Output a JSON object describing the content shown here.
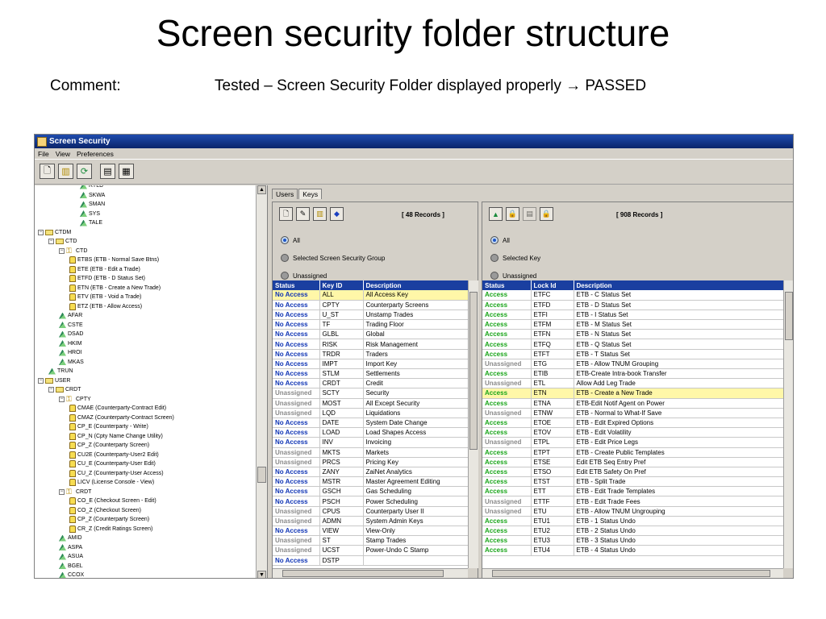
{
  "slide": {
    "title": "Screen security folder structure",
    "comment_label": "Comment:",
    "comment_text": "Tested – Screen Security Folder displayed properly → PASSED"
  },
  "window": {
    "title": "Screen Security"
  },
  "menu": [
    "File",
    "View",
    "Preferences"
  ],
  "toolbar_icons": [
    "new-document-icon",
    "trash-icon",
    "refresh-icon",
    "document-icon",
    "grid-icon"
  ],
  "tree": [
    {
      "label": "RTLD",
      "level": 4,
      "type": "group"
    },
    {
      "label": "SKWA",
      "level": 4,
      "type": "group"
    },
    {
      "label": "SMAN",
      "level": 4,
      "type": "group"
    },
    {
      "label": "SYS",
      "level": 4,
      "type": "group"
    },
    {
      "label": "TALE",
      "level": 4,
      "type": "group"
    },
    {
      "label": "CTDM",
      "level": 0,
      "type": "folder"
    },
    {
      "label": "CTD",
      "level": 1,
      "type": "folder"
    },
    {
      "label": "CTD",
      "level": 2,
      "type": "key"
    },
    {
      "label": "ETBS (ETB - Normal Save Btns)",
      "level": 3,
      "type": "lock"
    },
    {
      "label": "ETE  (ETB - Edit a Trade)",
      "level": 3,
      "type": "lock"
    },
    {
      "label": "ETFD (ETB - D Status Set)",
      "level": 3,
      "type": "lock"
    },
    {
      "label": "ETN  (ETB - Create a New Trade)",
      "level": 3,
      "type": "lock"
    },
    {
      "label": "ETV  (ETB - Void a Trade)",
      "level": 3,
      "type": "lock"
    },
    {
      "label": "ETZ  (ETB - Allow Access)",
      "level": 3,
      "type": "lock"
    },
    {
      "label": "AFAR",
      "level": 2,
      "type": "group"
    },
    {
      "label": "CSTE",
      "level": 2,
      "type": "group"
    },
    {
      "label": "DSAD",
      "level": 2,
      "type": "group"
    },
    {
      "label": "HKIM",
      "level": 2,
      "type": "group"
    },
    {
      "label": "HROI",
      "level": 2,
      "type": "group"
    },
    {
      "label": "MKAS",
      "level": 2,
      "type": "group"
    },
    {
      "label": "TRUN",
      "level": 1,
      "type": "group"
    },
    {
      "label": "USER",
      "level": 0,
      "type": "folder"
    },
    {
      "label": "CRDT",
      "level": 1,
      "type": "folder"
    },
    {
      "label": "CPTY",
      "level": 2,
      "type": "key"
    },
    {
      "label": "CMAE (Counterparty-Contract Edit)",
      "level": 3,
      "type": "lock"
    },
    {
      "label": "CMAZ (Counterparty-Contract Screen)",
      "level": 3,
      "type": "lock"
    },
    {
      "label": "CP_E (Counterparty - Write)",
      "level": 3,
      "type": "lock"
    },
    {
      "label": "CP_N (Cpty Name Change Utility)",
      "level": 3,
      "type": "lock"
    },
    {
      "label": "CP_Z (Counterparty Screen)",
      "level": 3,
      "type": "lock"
    },
    {
      "label": "CU2E (Counterparty-User2 Edit)",
      "level": 3,
      "type": "lock"
    },
    {
      "label": "CU_E (Counterparty-User Edit)",
      "level": 3,
      "type": "lock"
    },
    {
      "label": "CU_Z (Counterparty-User Access)",
      "level": 3,
      "type": "lock"
    },
    {
      "label": "LICV (License Console - View)",
      "level": 3,
      "type": "lock"
    },
    {
      "label": "CRDT",
      "level": 2,
      "type": "key"
    },
    {
      "label": "CO_E (Checkout Screen - Edit)",
      "level": 3,
      "type": "lock"
    },
    {
      "label": "CO_Z (Checkout Screen)",
      "level": 3,
      "type": "lock"
    },
    {
      "label": "CP_Z (Counterparty Screen)",
      "level": 3,
      "type": "lock"
    },
    {
      "label": "CR_Z (Credit Ratings Screen)",
      "level": 3,
      "type": "lock"
    },
    {
      "label": "AMID",
      "level": 2,
      "type": "group"
    },
    {
      "label": "ASPA",
      "level": 2,
      "type": "group"
    },
    {
      "label": "ASUA",
      "level": 2,
      "type": "group"
    },
    {
      "label": "BGEL",
      "level": 2,
      "type": "group"
    },
    {
      "label": "CCOX",
      "level": 2,
      "type": "group"
    }
  ],
  "tabs": [
    "Users",
    "Keys"
  ],
  "left_panel": {
    "record_count": "[ 48 Records ]",
    "radios": [
      "All",
      "Selected Screen Security Group",
      "Unassigned"
    ],
    "columns": [
      "Status",
      "Key ID",
      "Description"
    ],
    "rows": [
      [
        "No Access",
        "ALL",
        "All Access Key"
      ],
      [
        "No Access",
        "CPTY",
        "Counterparty Screens"
      ],
      [
        "No Access",
        "U_ST",
        "Unstamp Trades"
      ],
      [
        "No Access",
        "TF",
        "Trading Floor"
      ],
      [
        "No Access",
        "GLBL",
        "Global"
      ],
      [
        "No Access",
        "RISK",
        "Risk Management"
      ],
      [
        "No Access",
        "TRDR",
        "Traders"
      ],
      [
        "No Access",
        "IMPT",
        "Import Key"
      ],
      [
        "No Access",
        "STLM",
        "Settlements"
      ],
      [
        "No Access",
        "CRDT",
        "Credit"
      ],
      [
        "Unassigned",
        "SCTY",
        "Security"
      ],
      [
        "Unassigned",
        "MOST",
        "All Except Security"
      ],
      [
        "Unassigned",
        "LQD",
        "Liquidations"
      ],
      [
        "No Access",
        "DATE",
        "System Date Change"
      ],
      [
        "No Access",
        "LOAD",
        "Load Shapes Access"
      ],
      [
        "No Access",
        "INV",
        "Invoicing"
      ],
      [
        "Unassigned",
        "MKTS",
        "Markets"
      ],
      [
        "Unassigned",
        "PRCS",
        "Pricing Key"
      ],
      [
        "No Access",
        "ZANY",
        "ZaiNet Analytics"
      ],
      [
        "No Access",
        "MSTR",
        "Master Agreement Editing"
      ],
      [
        "No Access",
        "GSCH",
        "Gas Scheduling"
      ],
      [
        "No Access",
        "PSCH",
        "Power Scheduling"
      ],
      [
        "Unassigned",
        "CPUS",
        "Counterparty User II"
      ],
      [
        "Unassigned",
        "ADMN",
        "System Admin Keys"
      ],
      [
        "No Access",
        "VIEW",
        "View-Only"
      ],
      [
        "Unassigned",
        "ST",
        "Stamp Trades"
      ],
      [
        "Unassigned",
        "UCST",
        "Power-Undo C Stamp"
      ],
      [
        "No Access",
        "DSTP",
        ""
      ]
    ],
    "selected_row": 0
  },
  "right_panel": {
    "record_count": "[ 908 Records ]",
    "radios": [
      "All",
      "Selected Key",
      "Unassigned"
    ],
    "columns": [
      "Status",
      "Lock Id",
      "Description"
    ],
    "rows": [
      [
        "Access",
        "ETFC",
        "ETB - C Status Set"
      ],
      [
        "Access",
        "ETFD",
        "ETB - D Status Set"
      ],
      [
        "Access",
        "ETFI",
        "ETB - I Status Set"
      ],
      [
        "Access",
        "ETFM",
        "ETB - M Status Set"
      ],
      [
        "Access",
        "ETFN",
        "ETB - N Status Set"
      ],
      [
        "Access",
        "ETFQ",
        "ETB - Q Status Set"
      ],
      [
        "Access",
        "ETFT",
        "ETB - T Status Set"
      ],
      [
        "Unassigned",
        "ETG",
        "ETB - Allow TNUM Grouping"
      ],
      [
        "Access",
        "ETIB",
        "ETB-Create Intra-book Transfer"
      ],
      [
        "Unassigned",
        "ETL",
        "Allow Add Leg Trade"
      ],
      [
        "Access",
        "ETN",
        "ETB - Create a New Trade"
      ],
      [
        "Access",
        "ETNA",
        "ETB-Edit Notif Agent on Power"
      ],
      [
        "Unassigned",
        "ETNW",
        " ETB - Normal to What-If Save"
      ],
      [
        "Access",
        "ETOE",
        "ETB - Edit Expired Options"
      ],
      [
        "Access",
        "ETOV",
        "ETB - Edit Volatility"
      ],
      [
        "Unassigned",
        "ETPL",
        "ETB - Edit Price Legs"
      ],
      [
        "Access",
        "ETPT",
        "ETB - Create Public Templates"
      ],
      [
        "Access",
        "ETSE",
        "Edit ETB Seq Entry Pref"
      ],
      [
        "Access",
        "ETSO",
        "Edit ETB Safety On Pref"
      ],
      [
        "Access",
        "ETST",
        "ETB - Split Trade"
      ],
      [
        "Access",
        "ETT",
        "ETB - Edit Trade Templates"
      ],
      [
        "Unassigned",
        "ETTF",
        "ETB - Edit Trade Fees"
      ],
      [
        "Unassigned",
        "ETU",
        "ETB - Allow TNUM Ungrouping"
      ],
      [
        "Access",
        "ETU1",
        "ETB - 1 Status Undo"
      ],
      [
        "Access",
        "ETU2",
        "ETB - 2 Status Undo"
      ],
      [
        "Access",
        "ETU3",
        "ETB - 3 Status Undo"
      ],
      [
        "Access",
        "ETU4",
        "ETB - 4 Status Undo"
      ]
    ],
    "selected_row": 10
  }
}
